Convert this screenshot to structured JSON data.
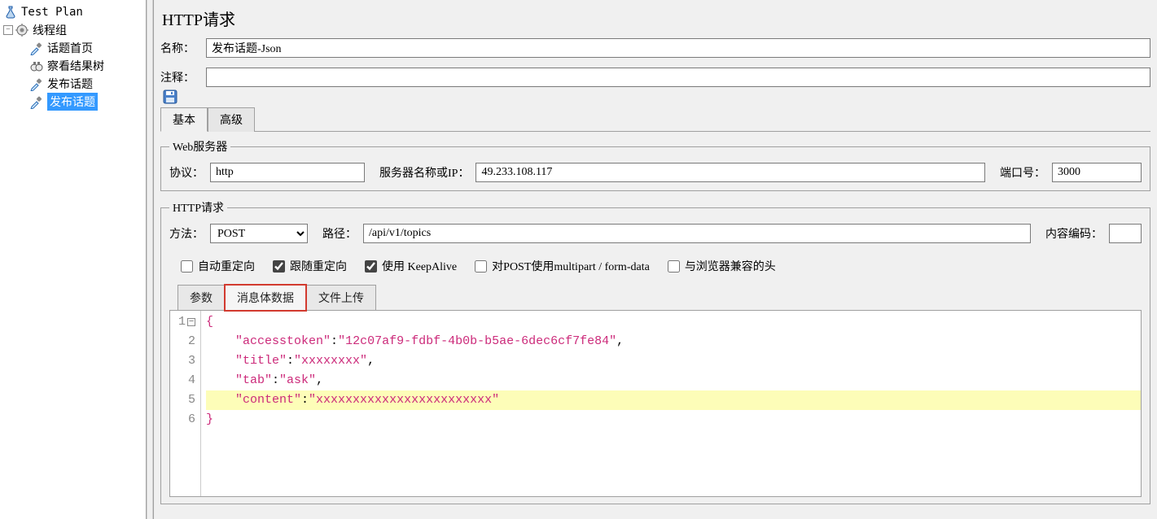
{
  "tree": {
    "root": "Test Plan",
    "threadGroup": "线程组",
    "items": [
      "话题首页",
      "察看结果树",
      "发布话题",
      "发布话题"
    ],
    "selectedIndex": 3
  },
  "header": {
    "title": "HTTP请求"
  },
  "form": {
    "nameLabel": "名称：",
    "nameValue": "发布话题-Json",
    "commentLabel": "注释：",
    "commentValue": ""
  },
  "topTabs": {
    "basic": "基本",
    "advanced": "高级"
  },
  "webServer": {
    "legend": "Web服务器",
    "protocolLabel": "协议：",
    "protocolValue": "http",
    "serverLabel": "服务器名称或IP：",
    "serverValue": "49.233.108.117",
    "portLabel": "端口号：",
    "portValue": "3000"
  },
  "httpRequest": {
    "legend": "HTTP请求",
    "methodLabel": "方法：",
    "methodValue": "POST",
    "pathLabel": "路径：",
    "pathValue": "/api/v1/topics",
    "encodingLabel": "内容编码：",
    "encodingValue": ""
  },
  "checks": {
    "autoRedirect": "自动重定向",
    "followRedirect": "跟随重定向",
    "keepAlive": "使用 KeepAlive",
    "multipart": "对POST使用multipart / form-data",
    "browserHeaders": "与浏览器兼容的头"
  },
  "bodyTabs": {
    "params": "参数",
    "bodyData": "消息体数据",
    "fileUpload": "文件上传"
  },
  "editor": {
    "lines": [
      {
        "n": "1",
        "fold": true,
        "segments": [
          {
            "t": "{",
            "c": "br"
          }
        ]
      },
      {
        "n": "2",
        "segments": [
          {
            "t": "    ",
            "c": "com"
          },
          {
            "t": "\"accesstoken\"",
            "c": "key"
          },
          {
            "t": ":",
            "c": "col"
          },
          {
            "t": "\"12c07af9-fdbf-4b0b-b5ae-6dec6cf7fe84\"",
            "c": "str"
          },
          {
            "t": ",",
            "c": "com"
          }
        ]
      },
      {
        "n": "3",
        "segments": [
          {
            "t": "    ",
            "c": "com"
          },
          {
            "t": "\"title\"",
            "c": "key"
          },
          {
            "t": ":",
            "c": "col"
          },
          {
            "t": "\"xxxxxxxx\"",
            "c": "str"
          },
          {
            "t": ",",
            "c": "com"
          }
        ]
      },
      {
        "n": "4",
        "segments": [
          {
            "t": "    ",
            "c": "com"
          },
          {
            "t": "\"tab\"",
            "c": "key"
          },
          {
            "t": ":",
            "c": "col"
          },
          {
            "t": "\"ask\"",
            "c": "str"
          },
          {
            "t": ",",
            "c": "com"
          }
        ]
      },
      {
        "n": "5",
        "hl": true,
        "segments": [
          {
            "t": "    ",
            "c": "com"
          },
          {
            "t": "\"content\"",
            "c": "key"
          },
          {
            "t": ":",
            "c": "col"
          },
          {
            "t": "\"xxxxxxxxxxxxxxxxxxxxxxxx\"",
            "c": "str"
          }
        ]
      },
      {
        "n": "6",
        "segments": [
          {
            "t": "}",
            "c": "br"
          }
        ]
      }
    ]
  }
}
